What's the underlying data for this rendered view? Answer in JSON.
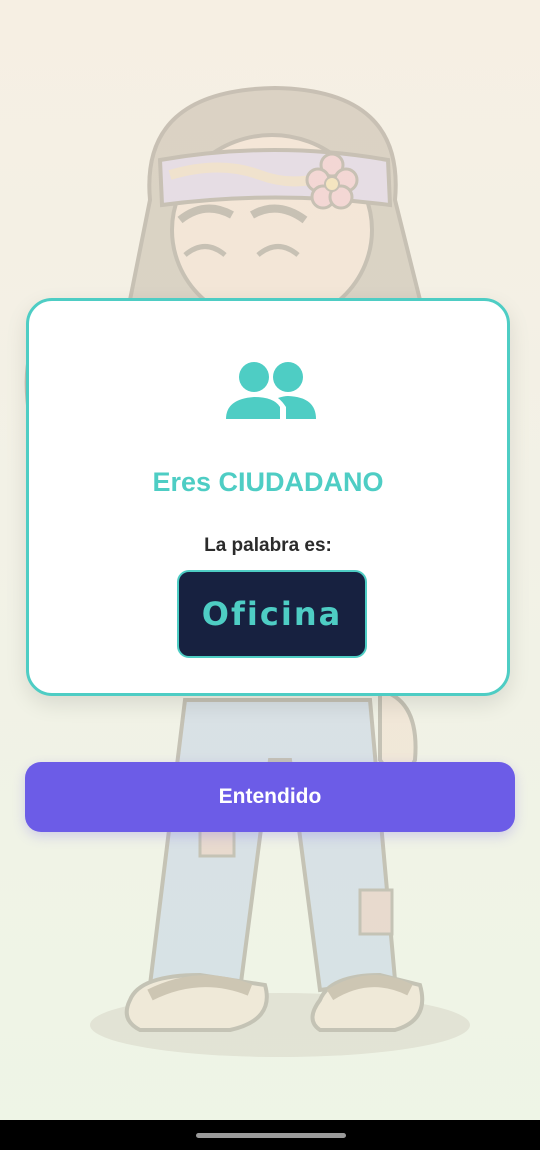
{
  "card": {
    "icon": "people-icon",
    "role_title": "Eres CIUDADANO",
    "word_label": "La palabra es:",
    "word": "Oficina"
  },
  "actions": {
    "confirm_label": "Entendido"
  },
  "background": {
    "illustration": "hippie-character-illustration"
  },
  "colors": {
    "accent_teal": "#4ecdc4",
    "button_purple": "#6c5ce7",
    "word_box_navy": "#172140"
  }
}
